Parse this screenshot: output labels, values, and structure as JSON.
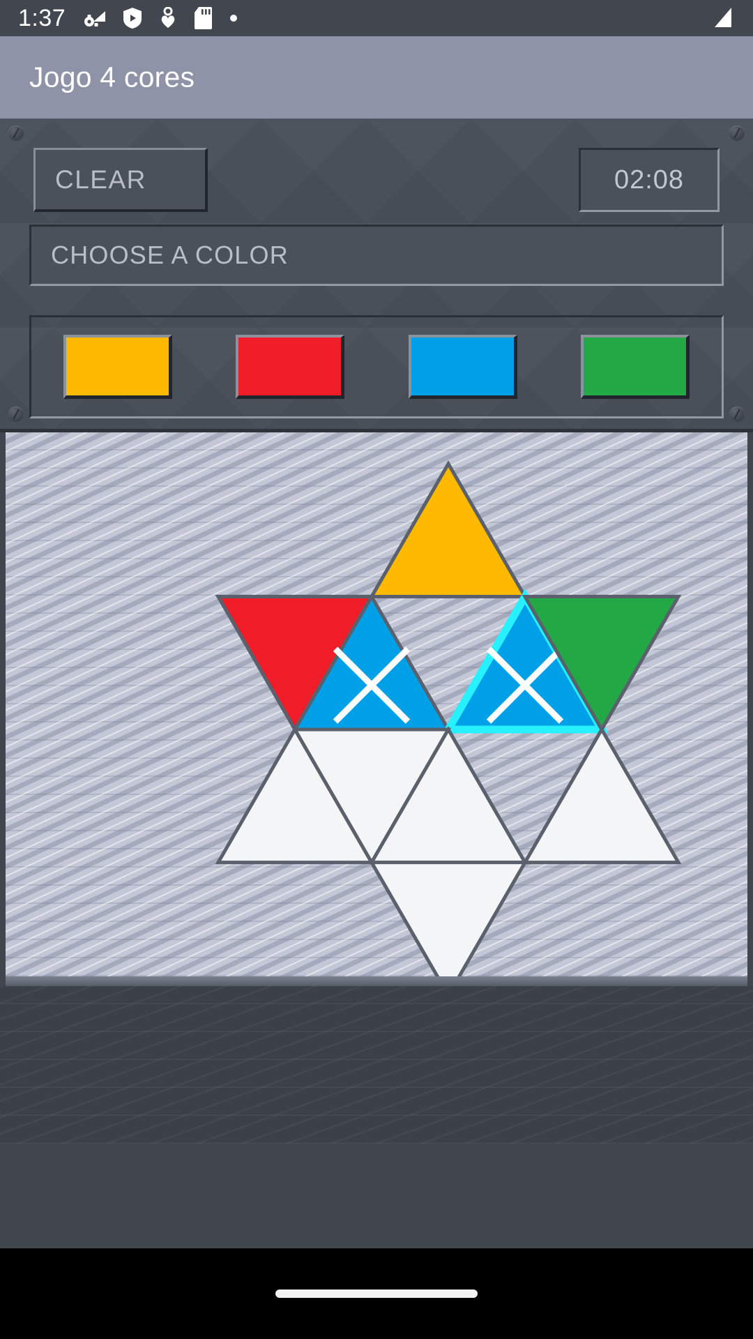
{
  "status_bar": {
    "clock": "1:37",
    "icons": [
      "settings-wifi-icon",
      "play-shield-icon",
      "heart-pin-icon",
      "sd-card-icon",
      "dot-icon"
    ],
    "right_icons": [
      "signal-icon"
    ]
  },
  "app_bar": {
    "title": "Jogo 4 cores",
    "background": "#8f93a8"
  },
  "controls": {
    "clear_label": "CLEAR",
    "timer_value": "02:08",
    "choose_label": "CHOOSE A COLOR",
    "swatches": [
      {
        "name": "yellow",
        "color": "#FFBA00"
      },
      {
        "name": "red",
        "color": "#F01C28"
      },
      {
        "name": "blue",
        "color": "#00A0E9"
      },
      {
        "name": "green",
        "color": "#22A845"
      }
    ]
  },
  "board": {
    "background": "#c3c7d6",
    "empty_fill": "#F4F5F7",
    "edge_dark": "#5b616c",
    "edge_light": "#d9dce6",
    "selected_outline": "#27F0FF",
    "marker": "x-mark",
    "cells": [
      {
        "id": "r0c3",
        "row": 0,
        "col": 3,
        "orientation": "up",
        "color": "#FFBA00",
        "state": "filled",
        "marked": false,
        "selected": false
      },
      {
        "id": "r1c1",
        "row": 1,
        "col": 1,
        "orientation": "down",
        "color": "#F01C28",
        "state": "filled",
        "marked": false,
        "selected": false
      },
      {
        "id": "r1c2",
        "row": 1,
        "col": 2,
        "orientation": "up",
        "color": "#00A0E9",
        "state": "filled",
        "marked": true,
        "selected": false
      },
      {
        "id": "r1c4",
        "row": 1,
        "col": 4,
        "orientation": "up",
        "color": "#00A0E9",
        "state": "filled",
        "marked": true,
        "selected": true
      },
      {
        "id": "r1c5",
        "row": 1,
        "col": 5,
        "orientation": "down",
        "color": "#22A845",
        "state": "filled",
        "marked": false,
        "selected": false
      },
      {
        "id": "r2c1",
        "row": 2,
        "col": 1,
        "orientation": "up",
        "color": "#F4F5F7",
        "state": "empty",
        "marked": false,
        "selected": false
      },
      {
        "id": "r2c2",
        "row": 2,
        "col": 2,
        "orientation": "down",
        "color": "#F4F5F7",
        "state": "empty",
        "marked": false,
        "selected": false
      },
      {
        "id": "r2c3",
        "row": 2,
        "col": 3,
        "orientation": "up",
        "color": "#F4F5F7",
        "state": "empty",
        "marked": false,
        "selected": false
      },
      {
        "id": "r2c5",
        "row": 2,
        "col": 5,
        "orientation": "up",
        "color": "#F4F5F7",
        "state": "empty",
        "marked": false,
        "selected": false
      },
      {
        "id": "r3c3",
        "row": 3,
        "col": 3,
        "orientation": "down",
        "color": "#F4F5F7",
        "state": "empty",
        "marked": false,
        "selected": false
      }
    ]
  },
  "nav_bar": {
    "gesture_pill": "home-pill"
  }
}
